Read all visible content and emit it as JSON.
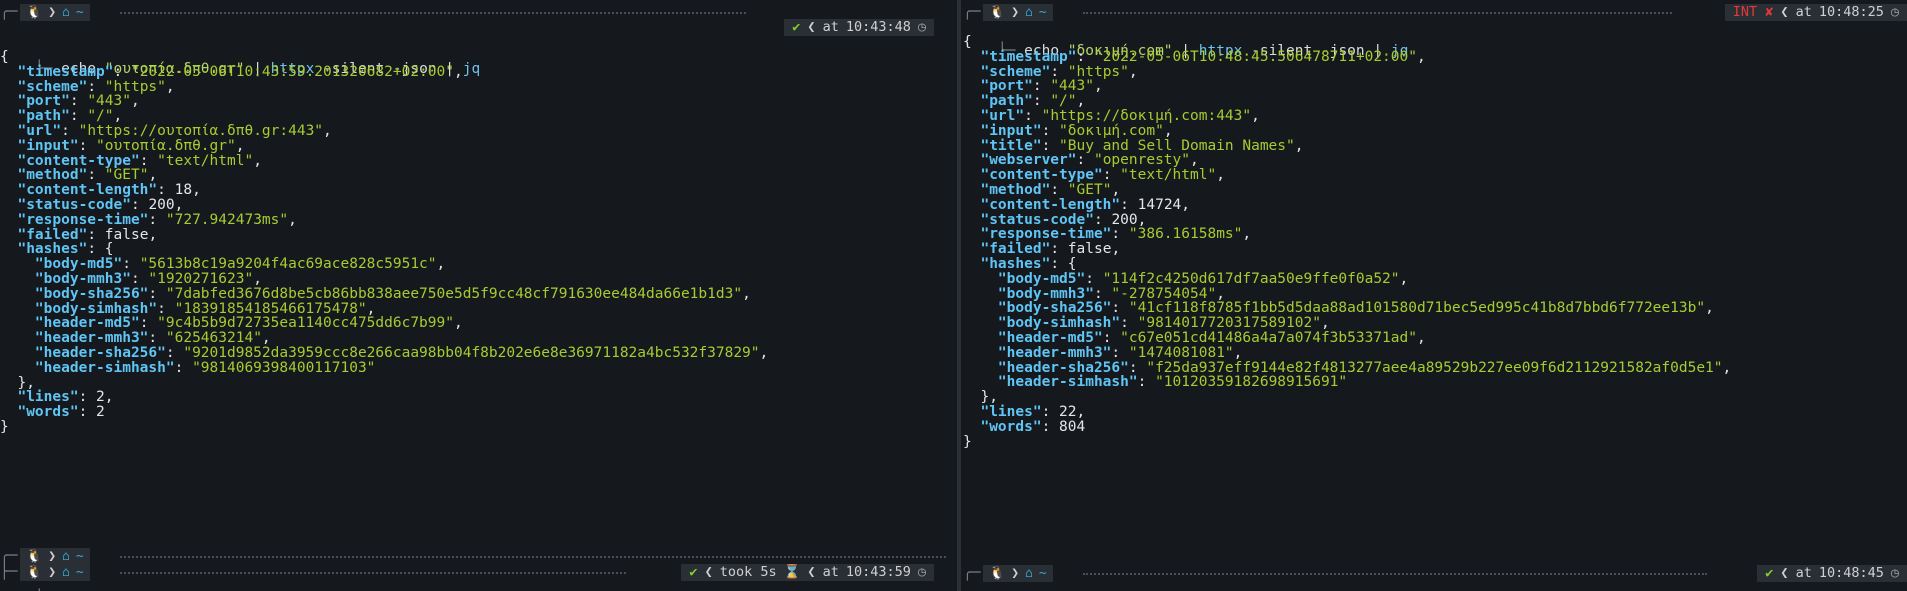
{
  "left": {
    "prompt_top": {
      "status_icon": "✔",
      "at": "at",
      "time": "10:43:48"
    },
    "command": {
      "prefix": "echo",
      "arg": "\"ουτοπία.δπθ.gr\"",
      "pipe1": "|",
      "tool1": "httpx",
      "flags": "-silent -json",
      "pipe2": "|",
      "tool2": "jq"
    },
    "json_lines": [
      {
        "t": "open"
      },
      {
        "k": "timestamp",
        "v": "\"2022-05-06T10:43:59.201320682+02:00\"",
        "s": true
      },
      {
        "k": "scheme",
        "v": "\"https\"",
        "s": true
      },
      {
        "k": "port",
        "v": "\"443\"",
        "s": true
      },
      {
        "k": "path",
        "v": "\"/\"",
        "s": true
      },
      {
        "k": "url",
        "v": "\"https://ουτοπία.δπθ.gr:443\"",
        "s": true
      },
      {
        "k": "input",
        "v": "\"ουτοπία.δπθ.gr\"",
        "s": true
      },
      {
        "k": "content-type",
        "v": "\"text/html\"",
        "s": true
      },
      {
        "k": "method",
        "v": "\"GET\"",
        "s": true
      },
      {
        "k": "content-length",
        "v": "18",
        "s": false
      },
      {
        "k": "status-code",
        "v": "200",
        "s": false
      },
      {
        "k": "response-time",
        "v": "\"727.942473ms\"",
        "s": true
      },
      {
        "k": "failed",
        "v": "false",
        "s": false
      },
      {
        "k": "hashes",
        "v": "{",
        "s": false,
        "nocomma": true
      },
      {
        "k": "body-md5",
        "v": "\"5613b8c19a9204f4ac69ace828c5951c\"",
        "s": true,
        "indent": 2
      },
      {
        "k": "body-mmh3",
        "v": "\"1920271623\"",
        "s": true,
        "indent": 2
      },
      {
        "k": "body-sha256",
        "v": "\"7dabfed3676d8be5cb86bb838aee750e5d5f9cc48cf791630ee484da66e1b1d3\"",
        "s": true,
        "indent": 2
      },
      {
        "k": "body-simhash",
        "v": "\"18391854185466175478\"",
        "s": true,
        "indent": 2
      },
      {
        "k": "header-md5",
        "v": "\"9c4b5b9d72735ea1140cc475dd6c7b99\"",
        "s": true,
        "indent": 2
      },
      {
        "k": "header-mmh3",
        "v": "\"625463214\"",
        "s": true,
        "indent": 2
      },
      {
        "k": "header-sha256",
        "v": "\"9201d9852da3959ccc8e266caa98bb04f8b202e6e8e36971182a4bc532f37829\"",
        "s": true,
        "indent": 2
      },
      {
        "k": "header-simhash",
        "v": "\"9814069398400117103\"",
        "s": true,
        "indent": 2,
        "nocomma": true
      },
      {
        "t": "closeinner"
      },
      {
        "k": "lines",
        "v": "2",
        "s": false
      },
      {
        "k": "words",
        "v": "2",
        "s": false,
        "nocomma": true
      },
      {
        "t": "close"
      }
    ],
    "prompt_bottom": {
      "status_icon": "✔",
      "took": "took 5s",
      "hourglass": "⌛",
      "at": "at",
      "time": "10:43:59"
    }
  },
  "right": {
    "prompt_top": {
      "status_icon": "INT ✘",
      "at": "at",
      "time": "10:48:25"
    },
    "command": {
      "prefix": "echo",
      "arg": "\"δοκιμή.com\"",
      "pipe1": "|",
      "tool1": "httpx",
      "flags": "-silent -json",
      "pipe2": "|",
      "tool2": "jq"
    },
    "json_lines": [
      {
        "t": "open"
      },
      {
        "k": "timestamp",
        "v": "\"2022-05-06T10:48:45.506478711+02:00\"",
        "s": true
      },
      {
        "k": "scheme",
        "v": "\"https\"",
        "s": true
      },
      {
        "k": "port",
        "v": "\"443\"",
        "s": true
      },
      {
        "k": "path",
        "v": "\"/\"",
        "s": true
      },
      {
        "k": "url",
        "v": "\"https://δοκιμή.com:443\"",
        "s": true
      },
      {
        "k": "input",
        "v": "\"δοκιμή.com\"",
        "s": true
      },
      {
        "k": "title",
        "v": "\"Buy and Sell Domain Names\"",
        "s": true
      },
      {
        "k": "webserver",
        "v": "\"openresty\"",
        "s": true
      },
      {
        "k": "content-type",
        "v": "\"text/html\"",
        "s": true
      },
      {
        "k": "method",
        "v": "\"GET\"",
        "s": true
      },
      {
        "k": "content-length",
        "v": "14724",
        "s": false
      },
      {
        "k": "status-code",
        "v": "200",
        "s": false
      },
      {
        "k": "response-time",
        "v": "\"386.16158ms\"",
        "s": true
      },
      {
        "k": "failed",
        "v": "false",
        "s": false
      },
      {
        "k": "hashes",
        "v": "{",
        "s": false,
        "nocomma": true
      },
      {
        "k": "body-md5",
        "v": "\"114f2c4250d617df7aa50e9ffe0f0a52\"",
        "s": true,
        "indent": 2
      },
      {
        "k": "body-mmh3",
        "v": "\"-278754054\"",
        "s": true,
        "indent": 2
      },
      {
        "k": "body-sha256",
        "v": "\"41cf118f8785f1bb5d5daa88ad101580d71bec5ed995c41b8d7bbd6f772ee13b\"",
        "s": true,
        "indent": 2
      },
      {
        "k": "body-simhash",
        "v": "\"9814017720317589102\"",
        "s": true,
        "indent": 2
      },
      {
        "k": "header-md5",
        "v": "\"c67e051cd41486a4a7a074f3b53371ad\"",
        "s": true,
        "indent": 2
      },
      {
        "k": "header-mmh3",
        "v": "\"1474081081\"",
        "s": true,
        "indent": 2
      },
      {
        "k": "header-sha256",
        "v": "\"f25da937eff9144e82f4813277aee4a89529b227ee09f6d2112921582af0d5e1\"",
        "s": true,
        "indent": 2
      },
      {
        "k": "header-simhash",
        "v": "\"10120359182698915691\"",
        "s": true,
        "indent": 2,
        "nocomma": true
      },
      {
        "t": "closeinner"
      },
      {
        "k": "lines",
        "v": "22",
        "s": false
      },
      {
        "k": "words",
        "v": "804",
        "s": false,
        "nocomma": true
      },
      {
        "t": "close"
      }
    ],
    "prompt_bottom": {
      "status_icon": "✔",
      "at": "at",
      "time": "10:48:45"
    }
  },
  "icons": {
    "os": "linux-icon",
    "home": "home-icon",
    "chevron": "chevron-right-icon",
    "clock": "clock-icon"
  },
  "home_glyph": "⌂",
  "tilde": "~",
  "colors": {
    "background": "#15181d",
    "key": "#5fc5f5",
    "string": "#a6cc32",
    "ok": "#7fd02b",
    "error": "#e03a3a"
  }
}
